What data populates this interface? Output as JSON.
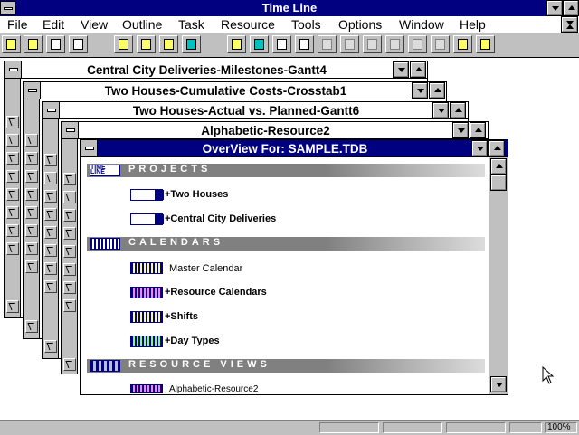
{
  "app": {
    "title": "Time Line"
  },
  "menu": {
    "file": "File",
    "edit": "Edit",
    "view": "View",
    "outline": "Outline",
    "task": "Task",
    "resource": "Resource",
    "tools": "Tools",
    "options": "Options",
    "window": "Window",
    "help": "Help"
  },
  "windows": {
    "w1": "Central City Deliveries-Milestones-Gantt4",
    "w2": "Two Houses-Cumulative Costs-Crosstab1",
    "w3": "Two Houses-Actual vs. Planned-Gantt6",
    "w4": "Alphabetic-Resource2",
    "overview": "OverView For: SAMPLE.TDB",
    "partial1": "Cu",
    "partial2": "Al"
  },
  "overview": {
    "projects_header": "PROJECTS",
    "projects": [
      "+Two Houses",
      "+Central City Deliveries"
    ],
    "calendars_header": "CALENDARS",
    "calendars": [
      "Master Calendar",
      "+Resource Calendars",
      "+Shifts",
      "+Day Types"
    ],
    "resource_views_header": "RESOURCE VIEWS",
    "resource_views": [
      "Alphabetic-Resource2"
    ],
    "icon_text": "TIME LINE"
  },
  "status": {
    "zoom": "100%"
  },
  "colors": {
    "titlebar": "#000080",
    "chrome": "#c0c0c0"
  }
}
